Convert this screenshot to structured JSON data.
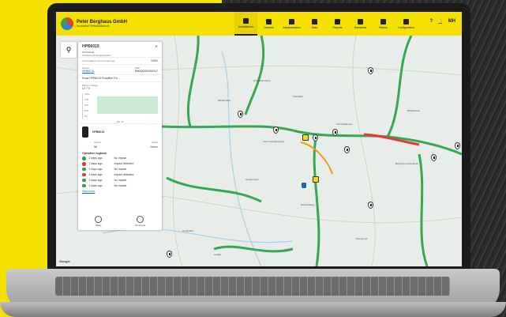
{
  "app": {
    "brand_name": "Peter Berghaus GmbH",
    "brand_sub": "Innovative Verkehrstechnik"
  },
  "nav": [
    {
      "label": "Installations",
      "active": true
    },
    {
      "label": "Devices",
      "active": false
    },
    {
      "label": "Administration",
      "active": false
    },
    {
      "label": "Data",
      "active": false
    },
    {
      "label": "Reports",
      "active": false
    },
    {
      "label": "Scenarios",
      "active": false
    },
    {
      "label": "History",
      "active": false
    },
    {
      "label": "Configuration",
      "active": false
    }
  ],
  "header_right": {
    "help": "?",
    "bell": "🔔",
    "user": "MH"
  },
  "panel": {
    "id": "HPB6019",
    "location": "Wichtswald",
    "location_sub": "Großenbach Beispielstraße",
    "last_update": "Last update a few seconds ago",
    "battery": "100%",
    "device_label": "Device",
    "device_value": "HPB6019",
    "imei_label": "IMEI",
    "imei_value": "866000000000917",
    "device_desc": "Road HPB6019 Roadline Fix...",
    "battery_voltage_label": "Battery voltage",
    "battery_voltage_value": "12.7 V",
    "chart_ticks": [
      "100%",
      "75%",
      "50%",
      "25%",
      "0%"
    ],
    "chart_x": "Mar 06",
    "unit_id": "HPB6019",
    "kv": [
      {
        "label": "Speed",
        "value": "56"
      },
      {
        "label": "Mode",
        "value": "Green"
      }
    ],
    "log_title": "Operation logbook",
    "log": [
      {
        "when": "2 days ago",
        "what": "No impact",
        "status": "ok"
      },
      {
        "when": "2 days ago",
        "what": "Impact detected",
        "status": "bad"
      },
      {
        "when": "2 days ago",
        "what": "No impact",
        "status": "ok"
      },
      {
        "when": "3 days ago",
        "what": "Impact detected",
        "status": "bad"
      },
      {
        "when": "3 days ago",
        "what": "No impact",
        "status": "ok"
      },
      {
        "when": "3 days ago",
        "what": "No impact",
        "status": "ok"
      }
    ],
    "view_more": "View more",
    "foot": [
      {
        "label": "Today"
      },
      {
        "label": "Tomorrow"
      }
    ]
  },
  "map": {
    "labels": [
      {
        "text": "Stommeln-Berghaus"
      },
      {
        "text": "Großenbach"
      },
      {
        "text": "Steinbach"
      },
      {
        "text": "Berghaus Kürtenbach"
      },
      {
        "text": "Berghausen"
      },
      {
        "text": "Rölcheshaus"
      },
      {
        "text": "Mühlenbach"
      },
      {
        "text": "Schmidthausen"
      },
      {
        "text": "Hohenfeld"
      },
      {
        "text": "Lindlar"
      },
      {
        "text": "Obergrund"
      },
      {
        "text": "Hof Kühlenhaus"
      }
    ],
    "google": "Google"
  }
}
